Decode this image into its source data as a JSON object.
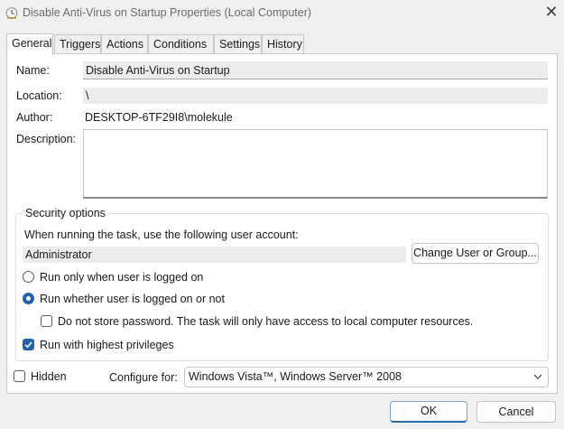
{
  "window": {
    "title": "Disable Anti-Virus on Startup Properties (Local Computer)",
    "close_glyph": "✕",
    "icon": "task-scheduler-clock-icon"
  },
  "tabs": [
    "General",
    "Triggers",
    "Actions",
    "Conditions",
    "Settings",
    "History"
  ],
  "active_tab": "General",
  "general": {
    "name_label": "Name:",
    "name_value": "Disable Anti-Virus on Startup",
    "location_label": "Location:",
    "location_value": "\\",
    "author_label": "Author:",
    "author_value": "DESKTOP-6TF29I8\\molekule",
    "description_label": "Description:",
    "description_value": ""
  },
  "security": {
    "group_title": "Security options",
    "account_prompt": "When running the task, use the following user account:",
    "account_value": "Administrator",
    "change_button": "Change User or Group...",
    "radio_logged_on": "Run only when user is logged on",
    "radio_logged_on_checked": false,
    "radio_whether": "Run whether user is logged on or not",
    "radio_whether_checked": true,
    "no_store_password": "Do not store password.  The task will only have access to local computer resources.",
    "no_store_password_checked": false,
    "highest_privileges": "Run with highest privileges",
    "highest_privileges_checked": true
  },
  "footer": {
    "hidden_label": "Hidden",
    "hidden_checked": false,
    "configure_label": "Configure for:",
    "configure_value": "Windows Vista™, Windows Server™ 2008"
  },
  "buttons": {
    "ok": "OK",
    "cancel": "Cancel"
  },
  "colors": {
    "accent": "#2463a8",
    "background": "#f0f0f0",
    "panel": "#ffffff"
  }
}
